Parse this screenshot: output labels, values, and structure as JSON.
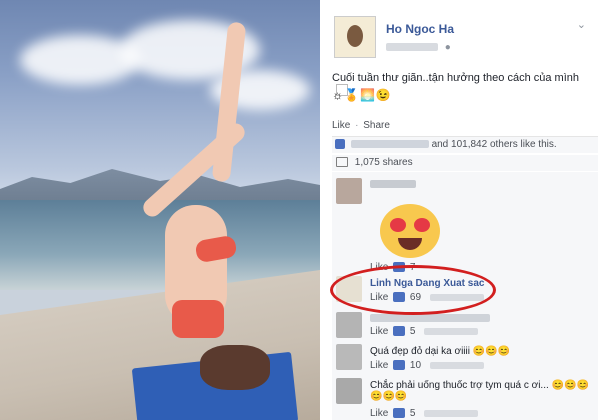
{
  "page": {
    "name": "Ho Ngoc Ha",
    "post_text": "Cuối tuần thư giãn..tận hưởng theo cách của mình",
    "post_emojis": "☼🏅🌅😉",
    "actions": {
      "like": "Like",
      "share": "Share"
    },
    "likes_text": "and 101,842 others like this.",
    "shares_text": "1,075 shares"
  },
  "comments": [
    {
      "name": "",
      "text": "",
      "meta": {
        "like": "Like",
        "count": "7"
      }
    },
    {
      "name": "Linh Nga Dang Xuat sac",
      "text": "",
      "meta": {
        "like": "Like",
        "count": "69"
      }
    },
    {
      "name": "",
      "text": "",
      "meta": {
        "like": "Like",
        "count": "5"
      }
    },
    {
      "name": "",
      "text": "Quá đẹp đỏ dại ka ơiiii 😊😊😊",
      "meta": {
        "like": "Like",
        "count": "10"
      }
    },
    {
      "name": "",
      "text": "Chắc phải uống thuốc trợ tym quá c ơi... 😊😊😊😊😊😊",
      "meta": {
        "like": "Like",
        "count": "5"
      }
    }
  ],
  "colors": {
    "link": "#3b5998",
    "highlight": "#d21f1f"
  }
}
